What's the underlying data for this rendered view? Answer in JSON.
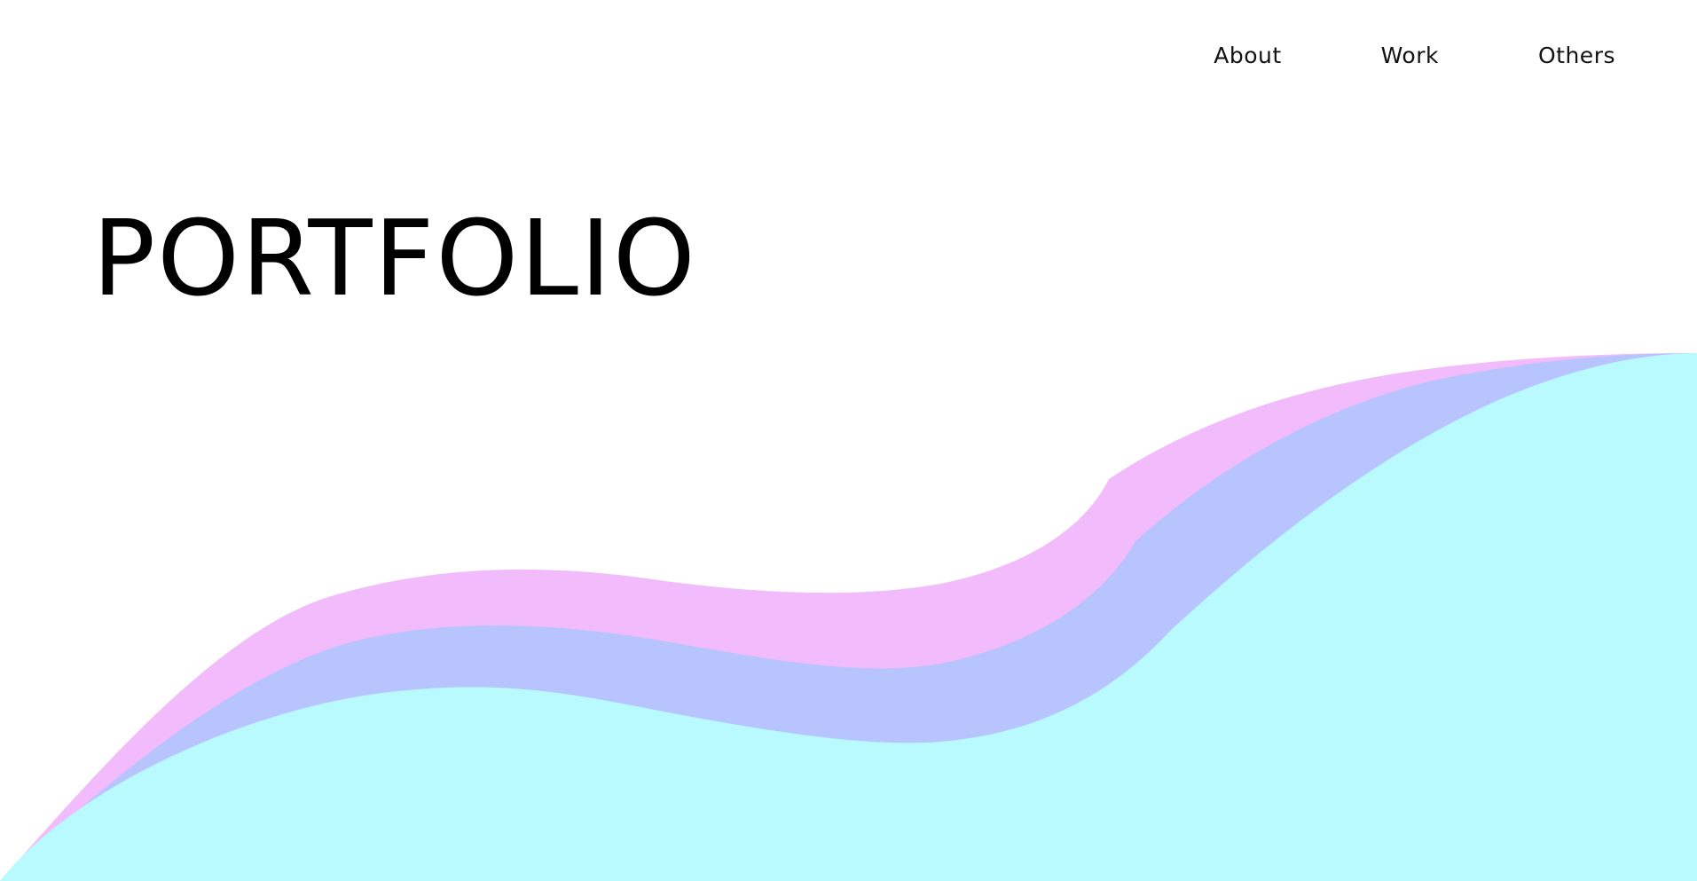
{
  "nav": {
    "items": [
      {
        "label": "About"
      },
      {
        "label": "Work"
      },
      {
        "label": "Others"
      }
    ]
  },
  "hero": {
    "title": "PORTFOLIO"
  },
  "colors": {
    "background": "#ffffff",
    "wave_pink": "#f2bcfc",
    "wave_lavender": "#b8c4fe",
    "wave_cyan": "#b8fafe",
    "text": "#000000"
  }
}
